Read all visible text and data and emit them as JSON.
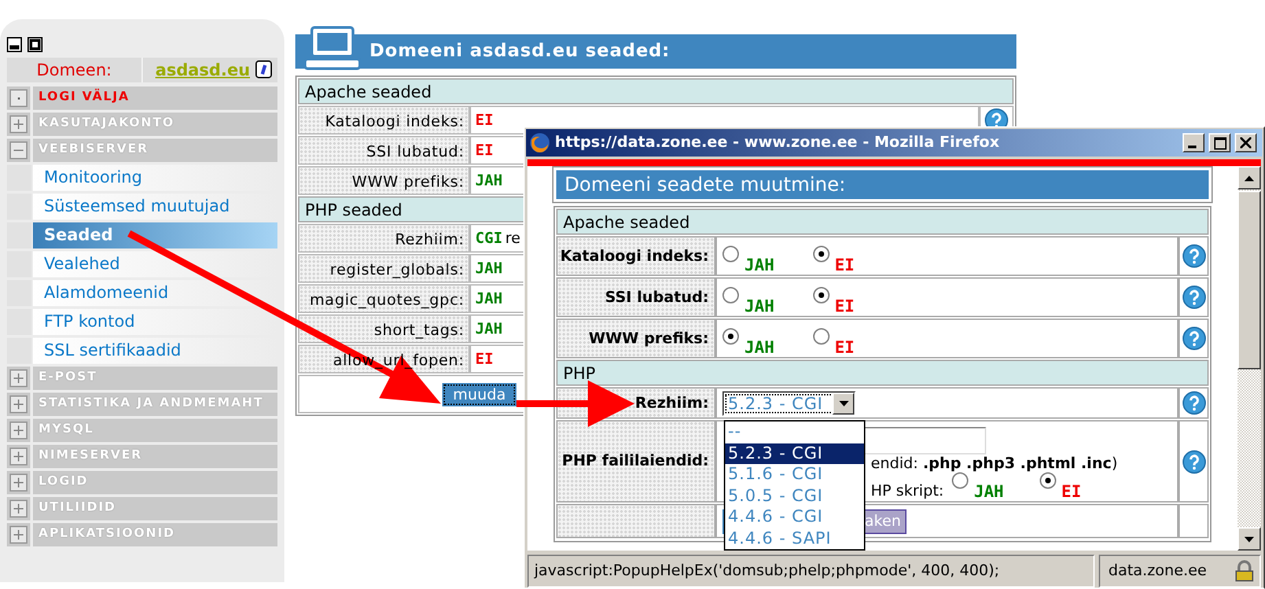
{
  "sidebar": {
    "domain_label": "Domeen:",
    "domain": "asdasd.eu",
    "items": [
      {
        "label": "LOGI VÄLJA",
        "kind": "logout"
      },
      {
        "label": "KASUTAJAKONTO",
        "kind": "section",
        "expanded": false
      },
      {
        "label": "VEEBISERVER",
        "kind": "section",
        "expanded": true,
        "children": [
          {
            "label": "Monitooring",
            "selected": false
          },
          {
            "label": "Süsteemsed muutujad",
            "selected": false
          },
          {
            "label": "Seaded",
            "selected": true
          },
          {
            "label": "Vealehed",
            "selected": false
          },
          {
            "label": "Alamdomeenid",
            "selected": false
          },
          {
            "label": "FTP kontod",
            "selected": false
          },
          {
            "label": "SSL sertifikaadid",
            "selected": false
          }
        ]
      },
      {
        "label": "E-POST",
        "kind": "section",
        "expanded": false
      },
      {
        "label": "STATISTIKA JA ANDMEMAHT",
        "kind": "section",
        "expanded": false
      },
      {
        "label": "MYSQL",
        "kind": "section",
        "expanded": false
      },
      {
        "label": "NIMESERVER",
        "kind": "section",
        "expanded": false
      },
      {
        "label": "LOGID",
        "kind": "section",
        "expanded": false
      },
      {
        "label": "UTILIIDID",
        "kind": "section",
        "expanded": false
      },
      {
        "label": "APLIKATSIOONID",
        "kind": "section",
        "expanded": false
      }
    ]
  },
  "page": {
    "title": "Domeeni asdasd.eu seaded:",
    "sections": [
      {
        "title": "Apache seaded",
        "rows": [
          {
            "label": "Kataloogi indeks:",
            "value": "EI",
            "color": "#ee0000",
            "help": true
          },
          {
            "label": "SSI lubatud:",
            "value": "EI",
            "color": "#ee0000"
          },
          {
            "label": "WWW prefiks:",
            "value": "JAH",
            "color": "#008000"
          }
        ]
      },
      {
        "title": "PHP seaded",
        "rows": [
          {
            "label": "Rezhiim:",
            "value": "CGI",
            "color": "#008000",
            "note": "re"
          },
          {
            "label": "register_globals:",
            "value": "JAH",
            "color": "#008000"
          },
          {
            "label": "magic_quotes_gpc:",
            "value": "JAH",
            "color": "#008000"
          },
          {
            "label": "short_tags:",
            "value": "JAH",
            "color": "#008000"
          },
          {
            "label": "allow_url_fopen:",
            "value": "EI",
            "color": "#ee0000"
          }
        ]
      }
    ],
    "button": "muuda"
  },
  "popup": {
    "title": "https://data.zone.ee - www.zone.ee - Mozilla Firefox",
    "header": "Domeeni seadete muutmine:",
    "sections": [
      {
        "title": "Apache seaded",
        "rows": [
          {
            "kind": "radio",
            "label": "Kataloogi indeks:",
            "options": [
              {
                "label": "JAH",
                "selected": false,
                "color": "#008000"
              },
              {
                "label": "EI",
                "selected": true,
                "color": "#ee0000"
              }
            ]
          },
          {
            "kind": "radio",
            "label": "SSI lubatud:",
            "options": [
              {
                "label": "JAH",
                "selected": false,
                "color": "#008000"
              },
              {
                "label": "EI",
                "selected": true,
                "color": "#ee0000"
              }
            ]
          },
          {
            "kind": "radio",
            "label": "WWW prefiks:",
            "options": [
              {
                "label": "JAH",
                "selected": true,
                "color": "#008000"
              },
              {
                "label": "EI",
                "selected": false,
                "color": "#ee0000"
              }
            ]
          }
        ]
      },
      {
        "title": "PHP",
        "rows": [
          {
            "kind": "select",
            "label": "Rezhiim:",
            "value": "5.2.3 - CGI",
            "expanded": true,
            "options": [
              {
                "label": "--",
                "selected": false
              },
              {
                "label": "5.2.3 - CGI",
                "selected": true
              },
              {
                "label": "5.1.6 - CGI",
                "selected": false
              },
              {
                "label": "5.0.5 - CGI",
                "selected": false
              },
              {
                "label": "4.4.6 - CGI",
                "selected": false
              },
              {
                "label": "4.4.6 - SAPI",
                "selected": false
              }
            ]
          },
          {
            "kind": "extensions",
            "label": "PHP faililaiendid:",
            "note": "endid: **.php .php3 .phtml .inc**)",
            "question": "HP skript:",
            "options": [
              {
                "label": "JAH",
                "selected": false,
                "color": "#008000"
              },
              {
                "label": "EI",
                "selected": true,
                "color": "#ee0000"
              }
            ]
          }
        ]
      }
    ],
    "buttons": [
      {
        "kind": "submit"
      },
      {
        "kind": "close",
        "label": "aken"
      }
    ],
    "status": "javascript:PopupHelpEx('domsub;phelp;phpmode', 400, 400);",
    "status_domain": "data.zone.ee"
  }
}
